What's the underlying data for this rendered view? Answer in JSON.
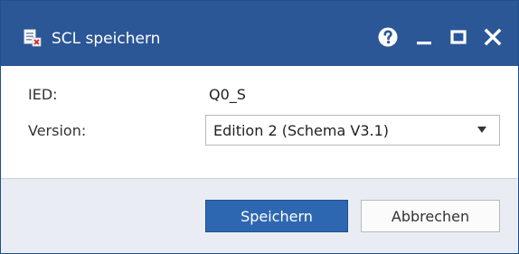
{
  "window": {
    "title": "SCL speichern",
    "icons": {
      "app": "scl-save-icon",
      "help": "help-icon",
      "minimize": "minimize-icon",
      "maximize": "maximize-icon",
      "close": "close-icon"
    }
  },
  "form": {
    "ied_label": "IED:",
    "ied_value": "Q0_S",
    "version_label": "Version:",
    "version_selected": "Edition 2 (Schema V3.1)"
  },
  "buttons": {
    "save_label": "Speichern",
    "cancel_label": "Abbrechen"
  },
  "colors": {
    "titlebar": "#2b5797",
    "primary_button": "#2e67b1",
    "footer": "#e9edf3"
  }
}
